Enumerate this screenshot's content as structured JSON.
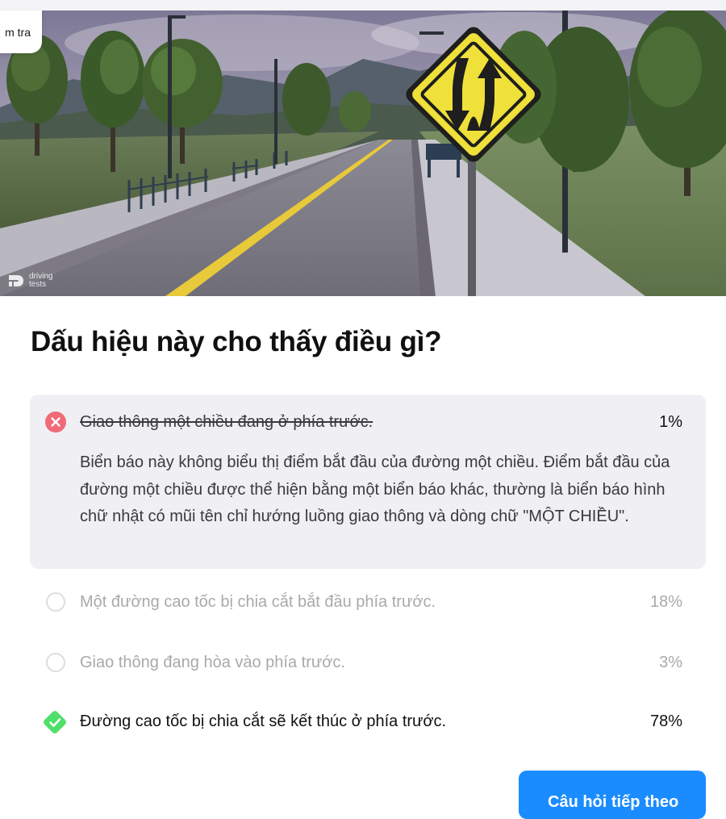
{
  "chip_text": "m tra",
  "watermark": {
    "line1": "driving",
    "line2": "tests"
  },
  "question": "Dấu hiệu này cho thấy điều gì?",
  "answers": [
    {
      "text": "Giao thông một chiều đang ở phía trước.",
      "percent": "1%",
      "state": "incorrect-selected",
      "icon": "x-circle-icon",
      "explanation": "Biển báo này không biểu thị điểm bắt đầu của đường một chiều. Điểm bắt đầu của đường một chiều được thể hiện bằng một biển báo khác, thường là biển báo hình chữ nhật có mũi tên chỉ hướng luồng giao thông và dòng chữ \"MỘT CHIỀU\"."
    },
    {
      "text": "Một đường cao tốc bị chia cắt bắt đầu phía trước.",
      "percent": "18%",
      "state": "unselected",
      "icon": "radio-icon"
    },
    {
      "text": "Giao thông đang hòa vào phía trước.",
      "percent": "3%",
      "state": "unselected",
      "icon": "radio-icon"
    },
    {
      "text": "Đường cao tốc bị chia cắt sẽ kết thúc ở phía trước.",
      "percent": "78%",
      "state": "correct",
      "icon": "check-diamond-icon"
    }
  ],
  "continue_button": "Câu hỏi tiếp theo",
  "colors": {
    "incorrect": "#f06a78",
    "correct": "#4ee06a",
    "primary": "#1a8cff",
    "sign_yellow": "#f2de2a"
  }
}
